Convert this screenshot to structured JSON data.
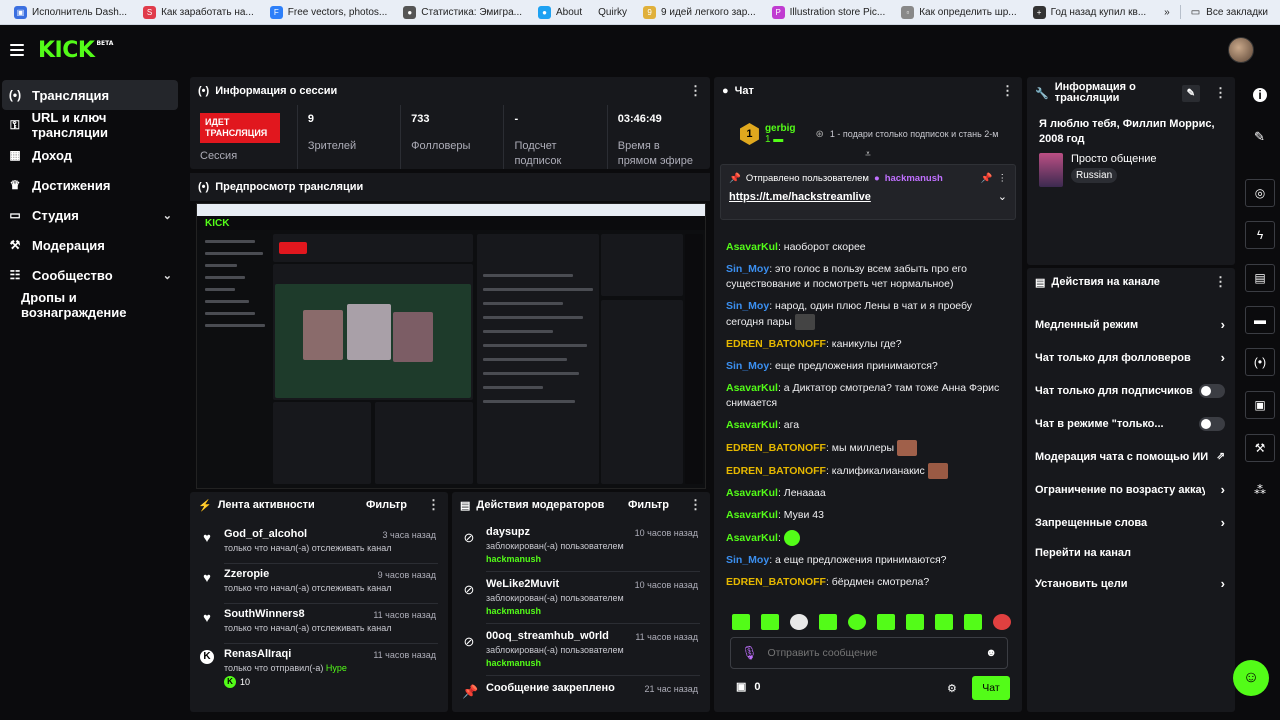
{
  "bookmarks": {
    "items": [
      {
        "label": "Исполнитель Dash...",
        "color": "#3b6fe0"
      },
      {
        "label": "Как заработать на...",
        "color": "#e03b4b"
      },
      {
        "label": "Free vectors, photos...",
        "color": "#2d7ff9"
      },
      {
        "label": "Статистика: Эмигра...",
        "color": "#555555"
      },
      {
        "label": "About",
        "color": "#1da1f2"
      },
      {
        "label": "Quirky",
        "color": "#666666"
      },
      {
        "label": "9 идей легкого зар...",
        "color": "#e0b03b"
      },
      {
        "label": "Illustration store Pic...",
        "color": "#c03bd1"
      },
      {
        "label": "Как определить шр...",
        "color": "#888888"
      },
      {
        "label": "Год назад купил кв...",
        "color": "#333333"
      }
    ],
    "all_bookmarks": "Все закладки"
  },
  "header": {
    "logo": "KICK",
    "logo_sup": "BETA"
  },
  "sidebar": {
    "items": [
      {
        "label": "Трансляция",
        "icon": "(•)"
      },
      {
        "label": "URL и ключ трансляции",
        "icon": "⚲"
      },
      {
        "label": "Доход",
        "icon": "▦"
      },
      {
        "label": "Достижения",
        "icon": "🏆"
      },
      {
        "label": "Студия",
        "icon": "▭"
      },
      {
        "label": "Модерация",
        "icon": "🔧"
      },
      {
        "label": "Сообщество",
        "icon": "👥"
      },
      {
        "label": "Дропы и вознаграждение",
        "icon": ""
      }
    ]
  },
  "session": {
    "title": "Информация о сессии",
    "badge": "ИДЕТ ТРАНСЛЯЦИЯ",
    "badge_label": "Сессия",
    "stats": [
      {
        "value": "9",
        "label": "Зрителей"
      },
      {
        "value": "733",
        "label": "Фолловеры"
      },
      {
        "value": "-",
        "label": "Подсчет подписок"
      },
      {
        "value": "03:46:49",
        "label": "Время в прямом эфире"
      }
    ]
  },
  "preview": {
    "title": "Предпросмотр трансляции"
  },
  "activity": {
    "title": "Лента активности",
    "filter": "Фильтр",
    "items": [
      {
        "name": "God_of_alcohol",
        "desc": "только что начал(-а) отслеживать канал",
        "time": "3 часа назад"
      },
      {
        "name": "Zzeropie",
        "desc": "только что начал(-а) отслеживать канал",
        "time": "9 часов назад"
      },
      {
        "name": "SouthWinners8",
        "desc": "только что начал(-а) отслеживать канал",
        "time": "11 часов назад"
      },
      {
        "name": "RenasAlIraqi",
        "desc_prefix": "только что отправил(-а)",
        "desc_suffix": "Hype",
        "hype_count": "10",
        "time": "11 часов назад"
      }
    ]
  },
  "modactions": {
    "title": "Действия модераторов",
    "filter": "Фильтр",
    "items": [
      {
        "name": "daysupz",
        "desc": "заблокирован(-а) пользователем",
        "by": "hackmanush",
        "time": "10 часов назад"
      },
      {
        "name": "WeLike2Muvit",
        "desc": "заблокирован(-а) пользователем",
        "by": "hackmanush",
        "time": "10 часов назад"
      },
      {
        "name": "00oq_streamhub_w0rld",
        "desc": "заблокирован(-а) пользователем",
        "by": "hackmanush",
        "time": "11 часов назад"
      },
      {
        "name": "Сообщение закреплено",
        "time": "21 час назад"
      }
    ]
  },
  "chat": {
    "title": "Чат",
    "gifter": {
      "rank": "1",
      "name": "gerbig",
      "count": "1"
    },
    "gift_text": "1 - подари столько подписок и стань 2-м",
    "pinned_label": "Отправлено пользователем",
    "pinned_user": "hackmanush",
    "pinned_link": "https://t.me/hackstreamlive",
    "messages": [
      {
        "user": "AsavarKul",
        "color": "#53fc18",
        "text": "наоборот скорее"
      },
      {
        "user": "Sin_Moy",
        "color": "#3b8ff0",
        "text": "это голос в пользу всем забыть про его существование и посмотреть чет нормальное)"
      },
      {
        "user": "Sin_Moy",
        "color": "#3b8ff0",
        "text": "народ, один плюс Лены в чат и я проебу сегодня пары"
      },
      {
        "user": "EDREN_BATONOFF",
        "color": "#e6b800",
        "text": "каникулы где?"
      },
      {
        "user": "Sin_Moy",
        "color": "#3b8ff0",
        "text": "еще предложения принимаются?"
      },
      {
        "user": "AsavarKul",
        "color": "#53fc18",
        "text": "а Диктатор смотрела? там тоже Анна Фэрис снимается"
      },
      {
        "user": "AsavarKul",
        "color": "#53fc18",
        "text": "ага"
      },
      {
        "user": "EDREN_BATONOFF",
        "color": "#e6b800",
        "text": "мы миллеры"
      },
      {
        "user": "EDREN_BATONOFF",
        "color": "#e6b800",
        "text": "калификалианакис"
      },
      {
        "user": "AsavarKul",
        "color": "#53fc18",
        "text": "Ленаааа"
      },
      {
        "user": "AsavarKul",
        "color": "#53fc18",
        "text": "Муви 43"
      },
      {
        "user": "AsavarKul",
        "color": "#53fc18",
        "text": ""
      },
      {
        "user": "Sin_Moy",
        "color": "#3b8ff0",
        "text": "а еще предложения принимаются?"
      },
      {
        "user": "EDREN_BATONOFF",
        "color": "#e6b800",
        "text": "бёрдмен смотрела?"
      }
    ],
    "input_placeholder": "Отправить сообщение",
    "points": "0",
    "send_label": "Чат"
  },
  "stream_info": {
    "title": "Информация о трансляции",
    "stream_title": "Я люблю тебя, Филлип Моррис, 2008 год",
    "category": "Просто общение",
    "language": "Russian"
  },
  "channel_actions": {
    "title": "Действия на канале",
    "items": [
      {
        "label": "Медленный режим",
        "type": "arrow"
      },
      {
        "label": "Чат только для фолловеров",
        "type": "arrow"
      },
      {
        "label": "Чат только для подписчиков",
        "type": "toggle"
      },
      {
        "label": "Чат в режиме \"только...",
        "type": "toggle"
      },
      {
        "label": "Модерация чата с помощью ИИ",
        "type": "external"
      },
      {
        "label": "Ограничение по возрасту аккау",
        "type": "arrow"
      },
      {
        "label": "Запрещенные слова",
        "type": "arrow"
      },
      {
        "label": "Перейти на канал",
        "type": "none"
      },
      {
        "label": "Установить цели",
        "type": "arrow"
      }
    ]
  },
  "colors": {
    "accent": "#53fc18",
    "live": "#e1171e",
    "panel": "#17181c"
  }
}
